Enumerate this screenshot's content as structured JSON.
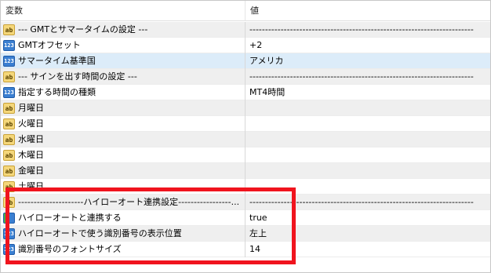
{
  "header": {
    "variable_label": "変数",
    "value_label": "値"
  },
  "rows": [
    {
      "icon": "ab-icon",
      "icon_text": "ab",
      "name": "--- GMTとサマータイムの設定 ---",
      "value": "------------------------------------------------------------------------"
    },
    {
      "icon": "number-icon",
      "icon_text": "123",
      "name": "GMTオフセット",
      "value": "+2"
    },
    {
      "icon": "number-icon",
      "icon_text": "123",
      "name": "サマータイム基準国",
      "value": "アメリカ"
    },
    {
      "icon": "ab-icon",
      "icon_text": "ab",
      "name": "--- サインを出す時間の設定 ---",
      "value": "------------------------------------------------------------------------"
    },
    {
      "icon": "number-icon",
      "icon_text": "123",
      "name": "指定する時間の種類",
      "value": "MT4時間"
    },
    {
      "icon": "ab-icon",
      "icon_text": "ab",
      "name": "月曜日",
      "value": ""
    },
    {
      "icon": "ab-icon",
      "icon_text": "ab",
      "name": "火曜日",
      "value": ""
    },
    {
      "icon": "ab-icon",
      "icon_text": "ab",
      "name": "水曜日",
      "value": ""
    },
    {
      "icon": "ab-icon",
      "icon_text": "ab",
      "name": "木曜日",
      "value": ""
    },
    {
      "icon": "ab-icon",
      "icon_text": "ab",
      "name": "金曜日",
      "value": ""
    },
    {
      "icon": "ab-icon",
      "icon_text": "ab",
      "name": "土曜日",
      "value": ""
    },
    {
      "icon": "ab-icon",
      "icon_text": "ab",
      "name": "---------------------ハイローオート連携設定-----------------...",
      "value": "------------------------------------------------------------------------"
    },
    {
      "icon": "bool-icon",
      "icon_text": "",
      "name": "ハイローオートと連携する",
      "value": "true"
    },
    {
      "icon": "number-icon",
      "icon_text": "123",
      "name": "ハイローオートで使う識別番号の表示位置",
      "value": "左上"
    },
    {
      "icon": "number-icon",
      "icon_text": "123",
      "name": "識別番号のフォントサイズ",
      "value": "14"
    }
  ],
  "row_styles": [
    "alt",
    "white",
    "sel",
    "alt",
    "white",
    "alt",
    "white",
    "alt",
    "white",
    "alt",
    "white",
    "alt",
    "white",
    "alt",
    "white"
  ],
  "colors": {
    "highlight": "#f0141e",
    "selected_row": "#dcecf9",
    "alt_row": "#efefef"
  }
}
